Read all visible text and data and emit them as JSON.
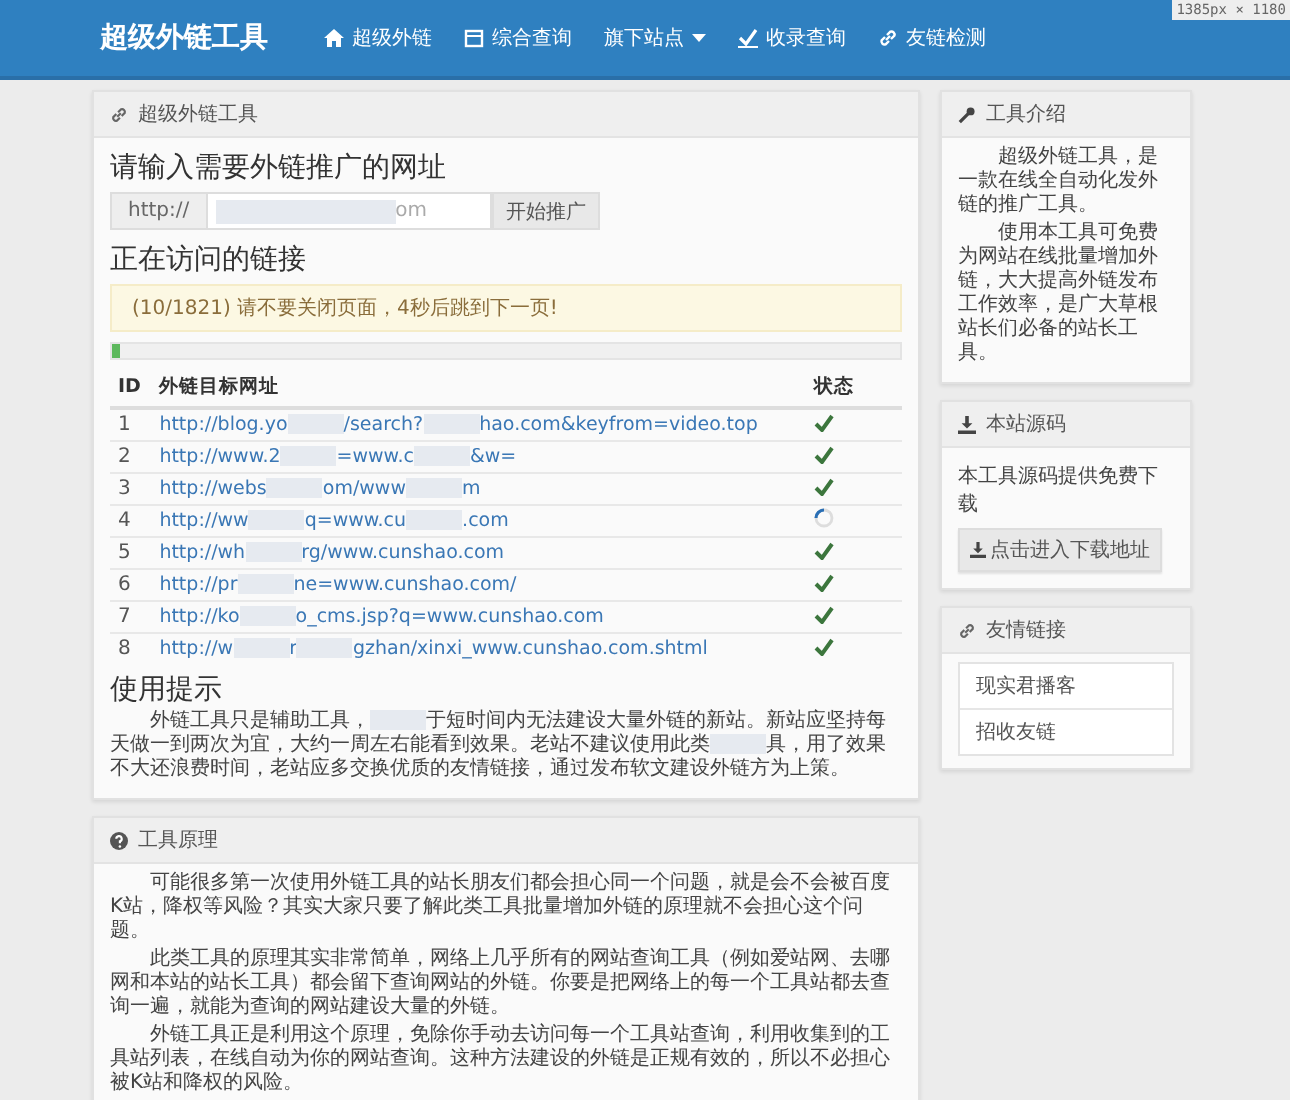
{
  "navbar": {
    "logo": "超级外链工具",
    "items": [
      {
        "label": "超级外链",
        "dropdown": false
      },
      {
        "label": "综合查询",
        "dropdown": false
      },
      {
        "label": "旗下站点",
        "dropdown": true
      },
      {
        "label": "收录查询",
        "dropdown": false
      },
      {
        "label": "友链检测",
        "dropdown": false
      }
    ],
    "size_overlay": "1385px × 1180"
  },
  "main_panel": {
    "title": "超级外链工具",
    "url_heading": "请输入需要外链推广的网址",
    "url_prefix": "http://",
    "url_value": "om",
    "submit_button": "开始推广",
    "visiting_heading": "正在访问的链接",
    "alert": "(10/1821) 请不要关闭页面，4秒后跳到下一页!",
    "progress": {
      "level": 0.01
    },
    "table": {
      "columns": [
        "ID",
        "外链目标网址",
        "状态"
      ],
      "rows": [
        {
          "id": "1",
          "url_parts": [
            "http://blog.yo",
            "/search?",
            "hao.com&keyfrom=video.top"
          ],
          "done": true
        },
        {
          "id": "2",
          "url_parts": [
            "http://www.2",
            "=www.c",
            "&w="
          ],
          "done": true
        },
        {
          "id": "3",
          "url_parts": [
            "http://webs",
            "om/www",
            "m"
          ],
          "done": true
        },
        {
          "id": "4",
          "url_parts": [
            "http://ww",
            "q=www.cu",
            ".com"
          ],
          "done": false
        },
        {
          "id": "5",
          "url_parts": [
            "http://wh",
            "rg/www.cunshao.com"
          ],
          "done": true
        },
        {
          "id": "6",
          "url_parts": [
            "http://pr",
            "ne=www.cunshao.com/"
          ],
          "done": true
        },
        {
          "id": "7",
          "url_parts": [
            "http://ko",
            "o_cms.jsp?q=www.cunshao.com"
          ],
          "done": true
        },
        {
          "id": "8",
          "url_parts": [
            "http://w",
            "r",
            "gzhan/xinxi_www.cunshao.com.shtml"
          ],
          "done": true
        }
      ]
    },
    "tips_heading": "使用提示",
    "tips_parts": [
      "外链工具只是辅助工具，",
      "于短时间内无法建设大量外链的新站。新站应坚持每天做一到两次为宜，大约一周左右能看到效果。老站不建议使用此类",
      "具，用了效果不大还浪费时间，老站应多交换优质的友情链接，通过发布软文建设外链方为上策。"
    ]
  },
  "principle_panel": {
    "title": "工具原理",
    "paragraphs": [
      "可能很多第一次使用外链工具的站长朋友们都会担心同一个问题，就是会不会被百度K站，降权等风险？其实大家只要了解此类工具批量增加外链的原理就不会担心这个问题。",
      "此类工具的原理其实非常简单，网络上几乎所有的网站查询工具（例如爱站网、去哪网和本站的站长工具）都会留下查询网站的外链。你要是把网络上的每一个工具站都去查询一遍，就能为查询的网站建设大量的外链。",
      "外链工具正是利用这个原理，免除你手动去访问每一个工具站查询，利用收集到的工具站列表，在线自动为你的网站查询。这种方法建设的外链是正规有效的，所以不必担心被K站和降权的风险。"
    ]
  },
  "sidebar": {
    "intro": {
      "title": "工具介绍",
      "paragraphs": [
        "超级外链工具，是一款在线全自动化发外链的推广工具。",
        "使用本工具可免费为网站在线批量增加外链，大大提高外链发布工作效率，是广大草根站长们必备的站长工具。"
      ]
    },
    "source": {
      "title": "本站源码",
      "text": "本工具源码提供免费下载",
      "button": "点击进入下载地址"
    },
    "links": {
      "title": "友情链接",
      "items": [
        "现实君播客",
        "招收友链"
      ]
    }
  }
}
